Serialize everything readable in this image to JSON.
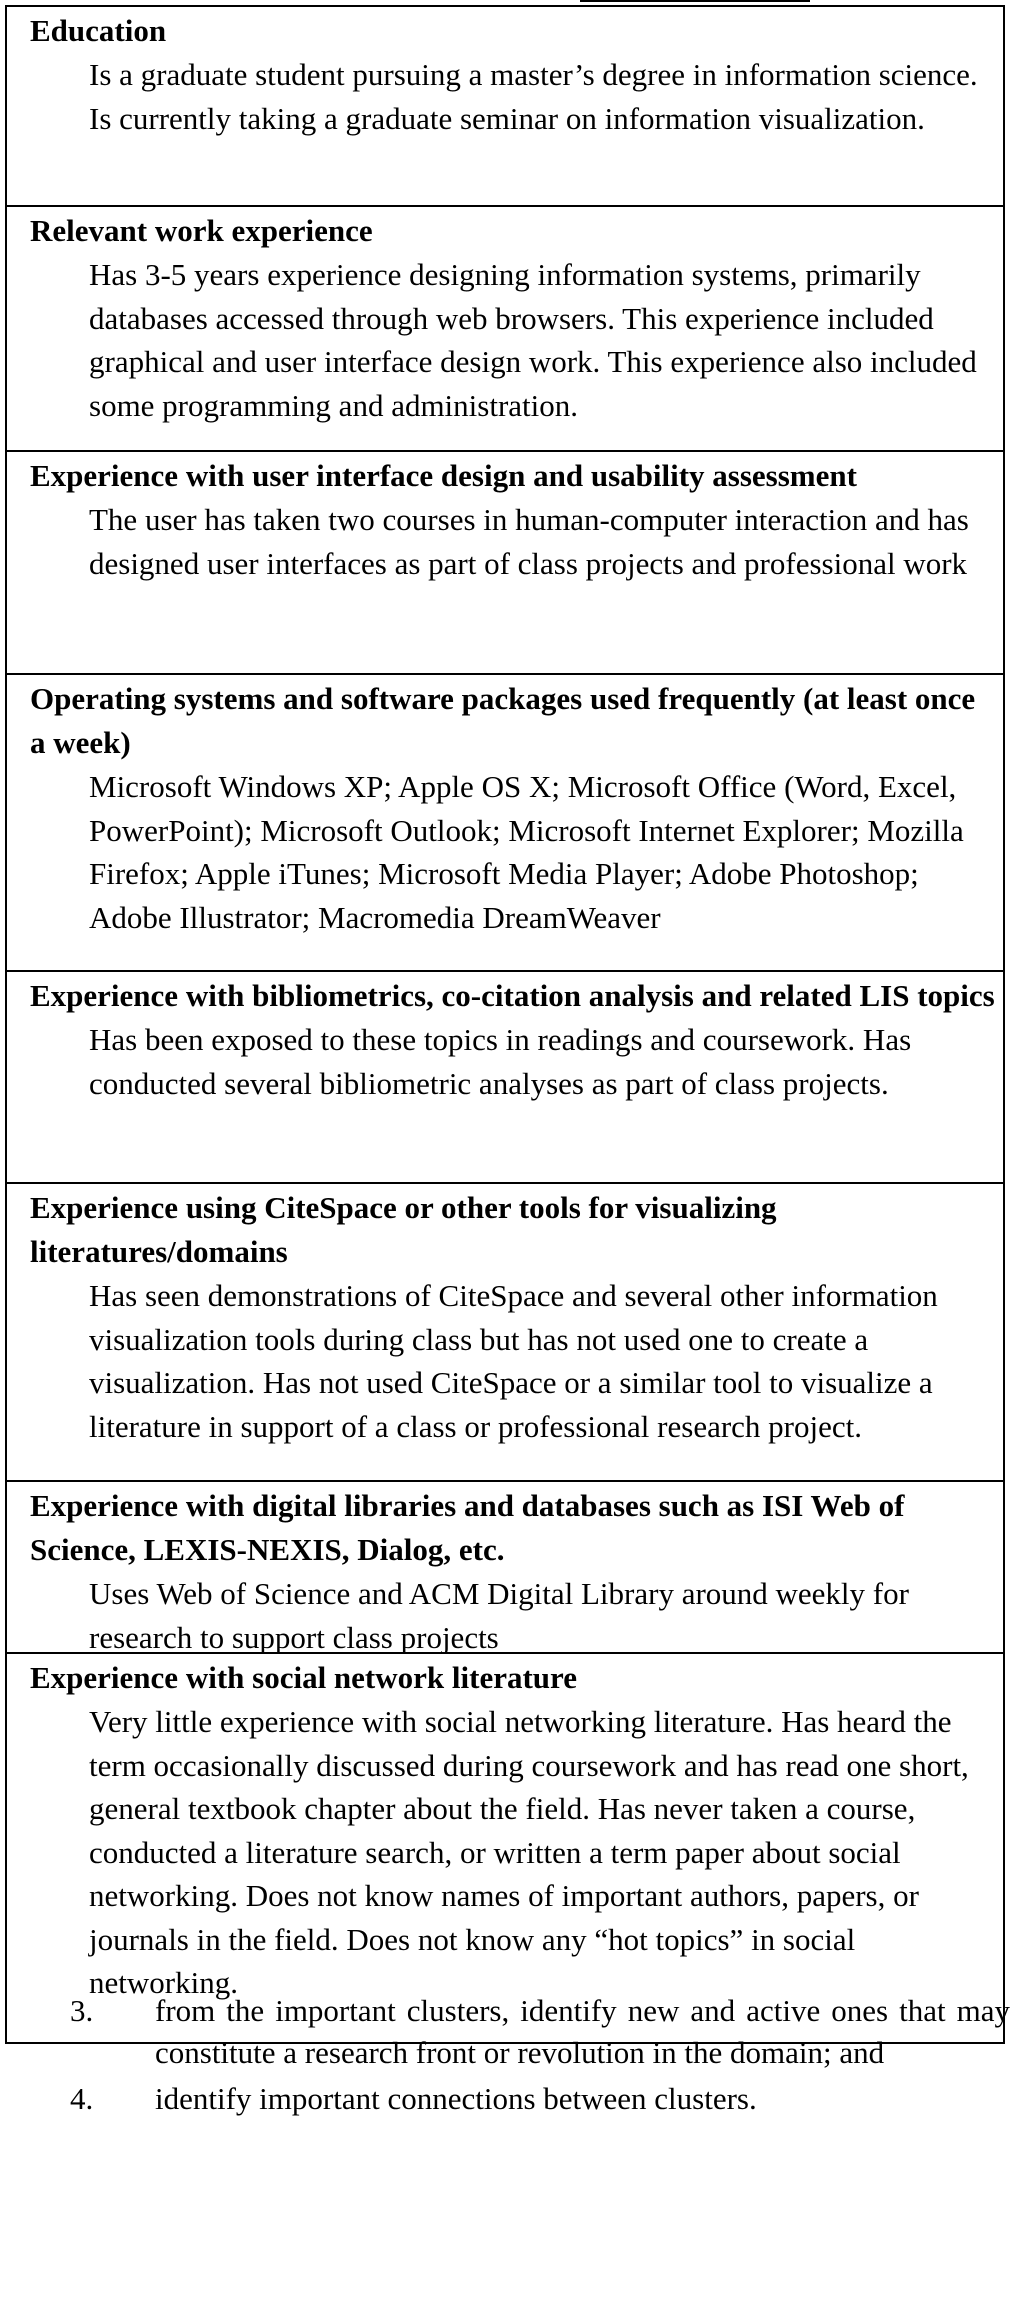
{
  "sections": [
    {
      "title": "Education",
      "body": "Is a graduate student pursuing a master’s degree in information science.  Is currently taking a graduate seminar on information visualization."
    },
    {
      "title": "Relevant work experience",
      "body": "Has 3-5 years experience designing information systems, primarily databases accessed through web browsers.  This experience included graphical and user interface design work.  This experience also included some programming and administration."
    },
    {
      "title": "Experience with user interface design and usability assessment",
      "body": "The user has taken two courses in human-computer interaction and has designed user interfaces as part of class projects and professional work"
    },
    {
      "title": "Operating systems and software packages used frequently (at least once a week)",
      "body": "Microsoft Windows XP; Apple OS X; Microsoft Office (Word, Excel, PowerPoint); Microsoft Outlook; Microsoft Internet Explorer; Mozilla Firefox; Apple iTunes; Microsoft Media Player; Adobe Photoshop; Adobe Illustrator; Macromedia DreamWeaver"
    },
    {
      "title": "Experience with bibliometrics, co-citation analysis and related LIS topics",
      "body": "Has been exposed to these topics in readings and coursework. Has conducted several bibliometric analyses as part of class projects."
    },
    {
      "title": "Experience using CiteSpace or other tools for visualizing literatures/domains",
      "body": "Has seen demonstrations of CiteSpace and several other information visualization tools during class but has not used one to create a visualization.  Has not used CiteSpace or a similar tool to visualize a literature in support of a class or professional research project."
    },
    {
      "title": "Experience with digital libraries and databases such as ISI Web of Science, LEXIS-NEXIS, Dialog, etc.",
      "body": "Uses Web of Science and ACM Digital Library around weekly for research to support class projects"
    },
    {
      "title": "Experience with social network literature",
      "body": "Very little experience with social networking literature. Has heard the term occasionally discussed during coursework and has read one short, general textbook chapter about the field. Has never taken a course, conducted a literature search, or written a term paper about social networking.  Does not know names of important authors, papers, or journals in the field.  Does not know any “hot topics” in social networking."
    }
  ],
  "list": [
    {
      "number": "3.",
      "text": "from the important clusters, identify new and active ones that may constitute a research front or revolution in the domain; and"
    },
    {
      "number": "4.",
      "text": "identify important connections between clusters."
    }
  ]
}
